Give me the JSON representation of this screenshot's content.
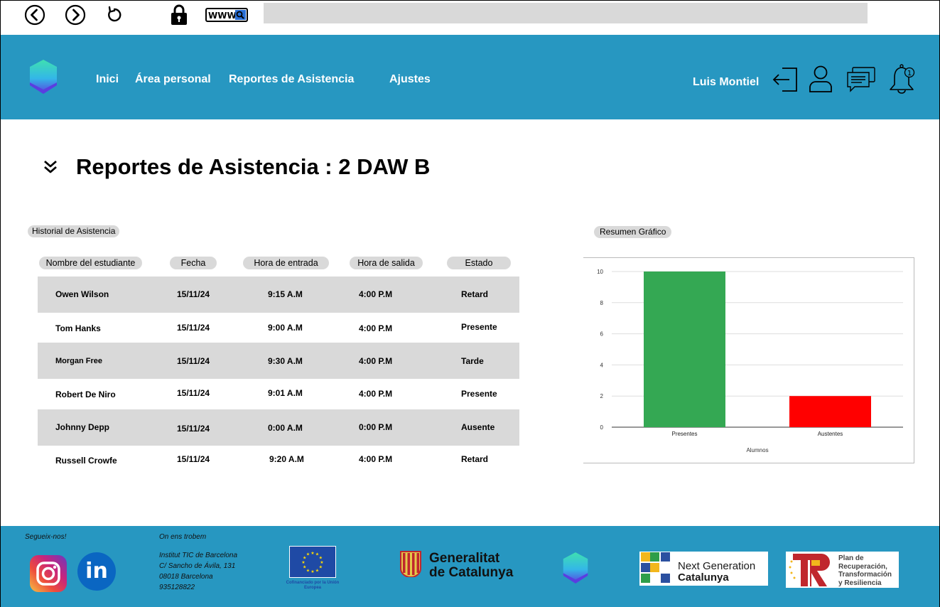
{
  "header": {
    "nav": [
      "Inici",
      "Área personal",
      "Reportes de Asistencia",
      "Ajustes"
    ],
    "user_name": "Luis Montiel",
    "icons": [
      "logout-icon",
      "user-icon",
      "chat-icon",
      "bell-icon"
    ],
    "notification_count": "1"
  },
  "browser": {
    "www_label": "WWW"
  },
  "main": {
    "title": "Reportes de Asistencia : 2 DAW B",
    "history_label": "Historial de Asistencia",
    "chart_label": "Resumen Gráfico"
  },
  "table": {
    "headers": [
      "Nombre del estudiante",
      "Fecha",
      "Hora de entrada",
      "Hora de salida",
      "Estado"
    ],
    "rows": [
      [
        "Owen Wilson",
        "15/11/24",
        "9:15 A.M",
        "4:00 P.M",
        "Retard"
      ],
      [
        "Tom Hanks",
        "15/11/24",
        "9:00 A.M",
        "4:00 P.M",
        "Presente"
      ],
      [
        "Morgan Free",
        "15/11/24",
        "9:30 A.M",
        "4:00 P.M",
        "Tarde"
      ],
      [
        "Robert De Niro",
        "15/11/24",
        "9:01 A.M",
        "4:00 P.M",
        "Presente"
      ],
      [
        "Johnny Depp",
        "15/11/24",
        "0:00 A.M",
        "0:00 P.M",
        "Ausente"
      ],
      [
        "Russell Crowfe",
        "15/11/24",
        "9:20 A.M",
        "4:00 P.M",
        "Retard"
      ]
    ]
  },
  "chart_data": {
    "type": "bar",
    "categories": [
      "Presentes",
      "Austentes"
    ],
    "values": [
      10,
      2
    ],
    "colors": [
      "#34a853",
      "#ff0000"
    ],
    "xlabel": "Alumnos",
    "ylabel": "",
    "ylim": [
      0,
      10
    ],
    "yticks": [
      0,
      2,
      4,
      6,
      8,
      10
    ],
    "grid": true
  },
  "footer": {
    "follow_label": "Segueix-nos!",
    "find_label": "On ens trobem",
    "address_lines": [
      "Institut TIC de Barcelona",
      "C/ Sancho de Ávila, 131",
      "08018 Barcelona",
      "935128822"
    ],
    "linkedin_text": "in",
    "eu_text": "Cofinanciado por la Unión Europea",
    "gencat_lines": [
      "Generalitat",
      "de Catalunya"
    ],
    "ngc_lines": [
      "Next Generation",
      "Catalunya"
    ],
    "prtr_lines": [
      "Plan de",
      "Recuperación,",
      "Transformación",
      "y Resiliencia"
    ]
  }
}
